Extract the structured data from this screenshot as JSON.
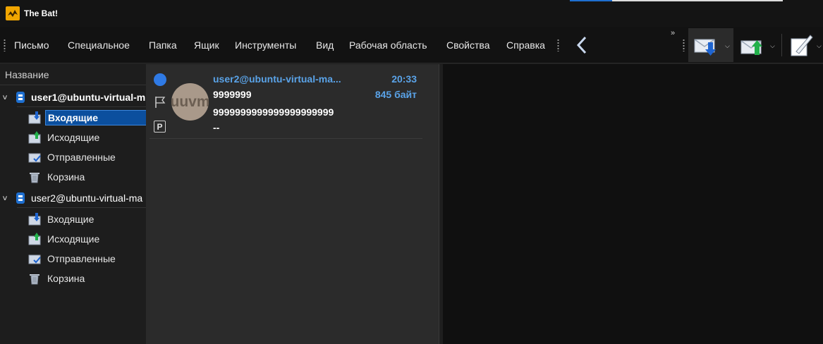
{
  "app": {
    "title": "The Bat!"
  },
  "menu": {
    "items": [
      "Письмо",
      "Специальное",
      "Папка",
      "Ящик",
      "Инструменты",
      "Вид",
      "Рабочая область",
      "Свойства",
      "Справка"
    ]
  },
  "folders": {
    "header": "Название",
    "accounts": [
      {
        "name": "user1@ubuntu-virtual-m",
        "expanded": true,
        "folders": [
          {
            "label": "Входящие",
            "selected": true,
            "icon": "inbox-icon"
          },
          {
            "label": "Исходящие",
            "icon": "outbox-icon"
          },
          {
            "label": "Отправленные",
            "icon": "sent-icon"
          },
          {
            "label": "Корзина",
            "icon": "trash-icon"
          }
        ]
      },
      {
        "name": "user2@ubuntu-virtual-ma",
        "expanded": true,
        "folders": [
          {
            "label": "Входящие",
            "icon": "inbox-icon"
          },
          {
            "label": "Исходящие",
            "icon": "outbox-icon"
          },
          {
            "label": "Отправленные",
            "icon": "sent-icon"
          },
          {
            "label": "Корзина",
            "icon": "trash-icon"
          }
        ]
      }
    ]
  },
  "messages": [
    {
      "from": "user2@ubuntu-virtual-ma...",
      "time": "20:33",
      "subject": "9999999",
      "size": "845 байт",
      "preview_line1": "9999999999999999999999",
      "preview_line2": "--",
      "avatar_initials": "uuvm",
      "priority_letter": "P",
      "unread": true
    }
  ],
  "colors": {
    "accent_blue": "#2f7ae5",
    "link_blue": "#5aa3e8",
    "selection": "#0b4f9e",
    "avatar_bg": "#a9998a"
  }
}
